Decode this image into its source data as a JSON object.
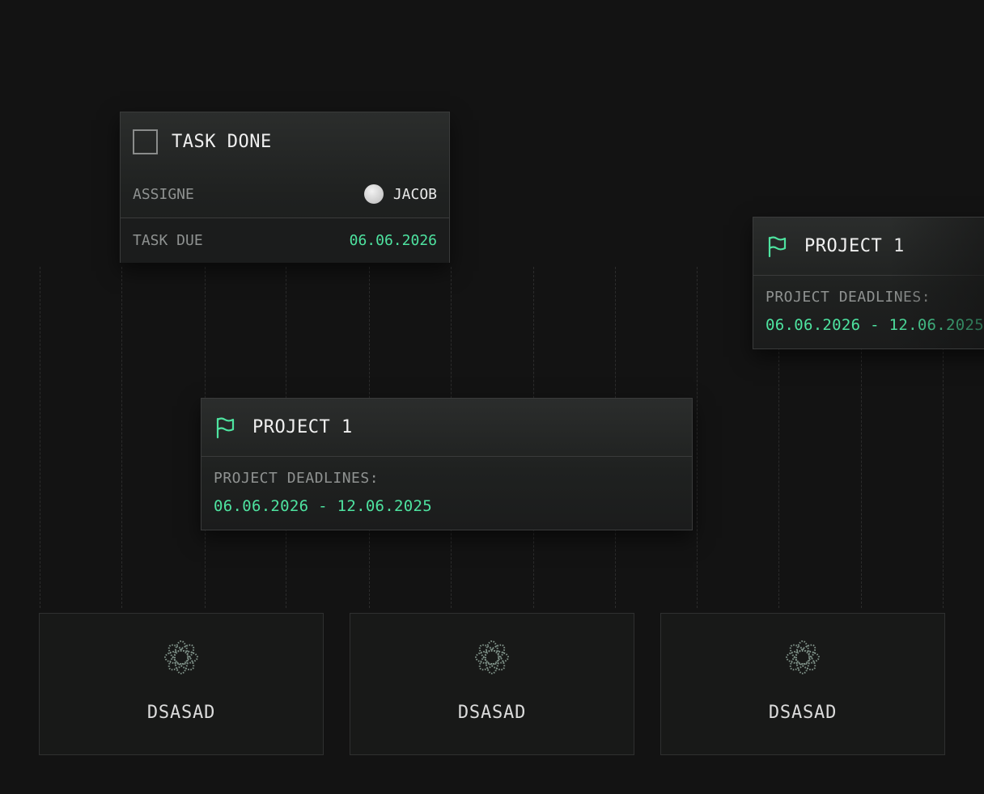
{
  "task_card": {
    "title": "TASK DONE",
    "assignee_label": "ASSIGNE",
    "assignee_name": "JACOB",
    "due_label": "TASK DUE",
    "due_date": "06.06.2026"
  },
  "project_cards": [
    {
      "title": "PROJECT 1",
      "deadlines_label": "PROJECT DEADLINES:",
      "deadline_range": "06.06.2026 - 12.06.2025"
    },
    {
      "title": "PROJECT 1",
      "deadlines_label": "PROJECT DEADLINES:",
      "deadline_range": "06.06.2026 - 12.06.2025"
    }
  ],
  "tiles": [
    {
      "name": "DSASAD",
      "icon": "flower-knot-icon"
    },
    {
      "name": "DSASAD",
      "icon": "flower-knot-icon"
    },
    {
      "name": "DSASAD",
      "icon": "flower-knot-icon"
    }
  ],
  "colors": {
    "accent": "#4ee3a0",
    "background": "#131313",
    "card_border": "#3a3b3b",
    "muted_text": "#8f9291"
  }
}
